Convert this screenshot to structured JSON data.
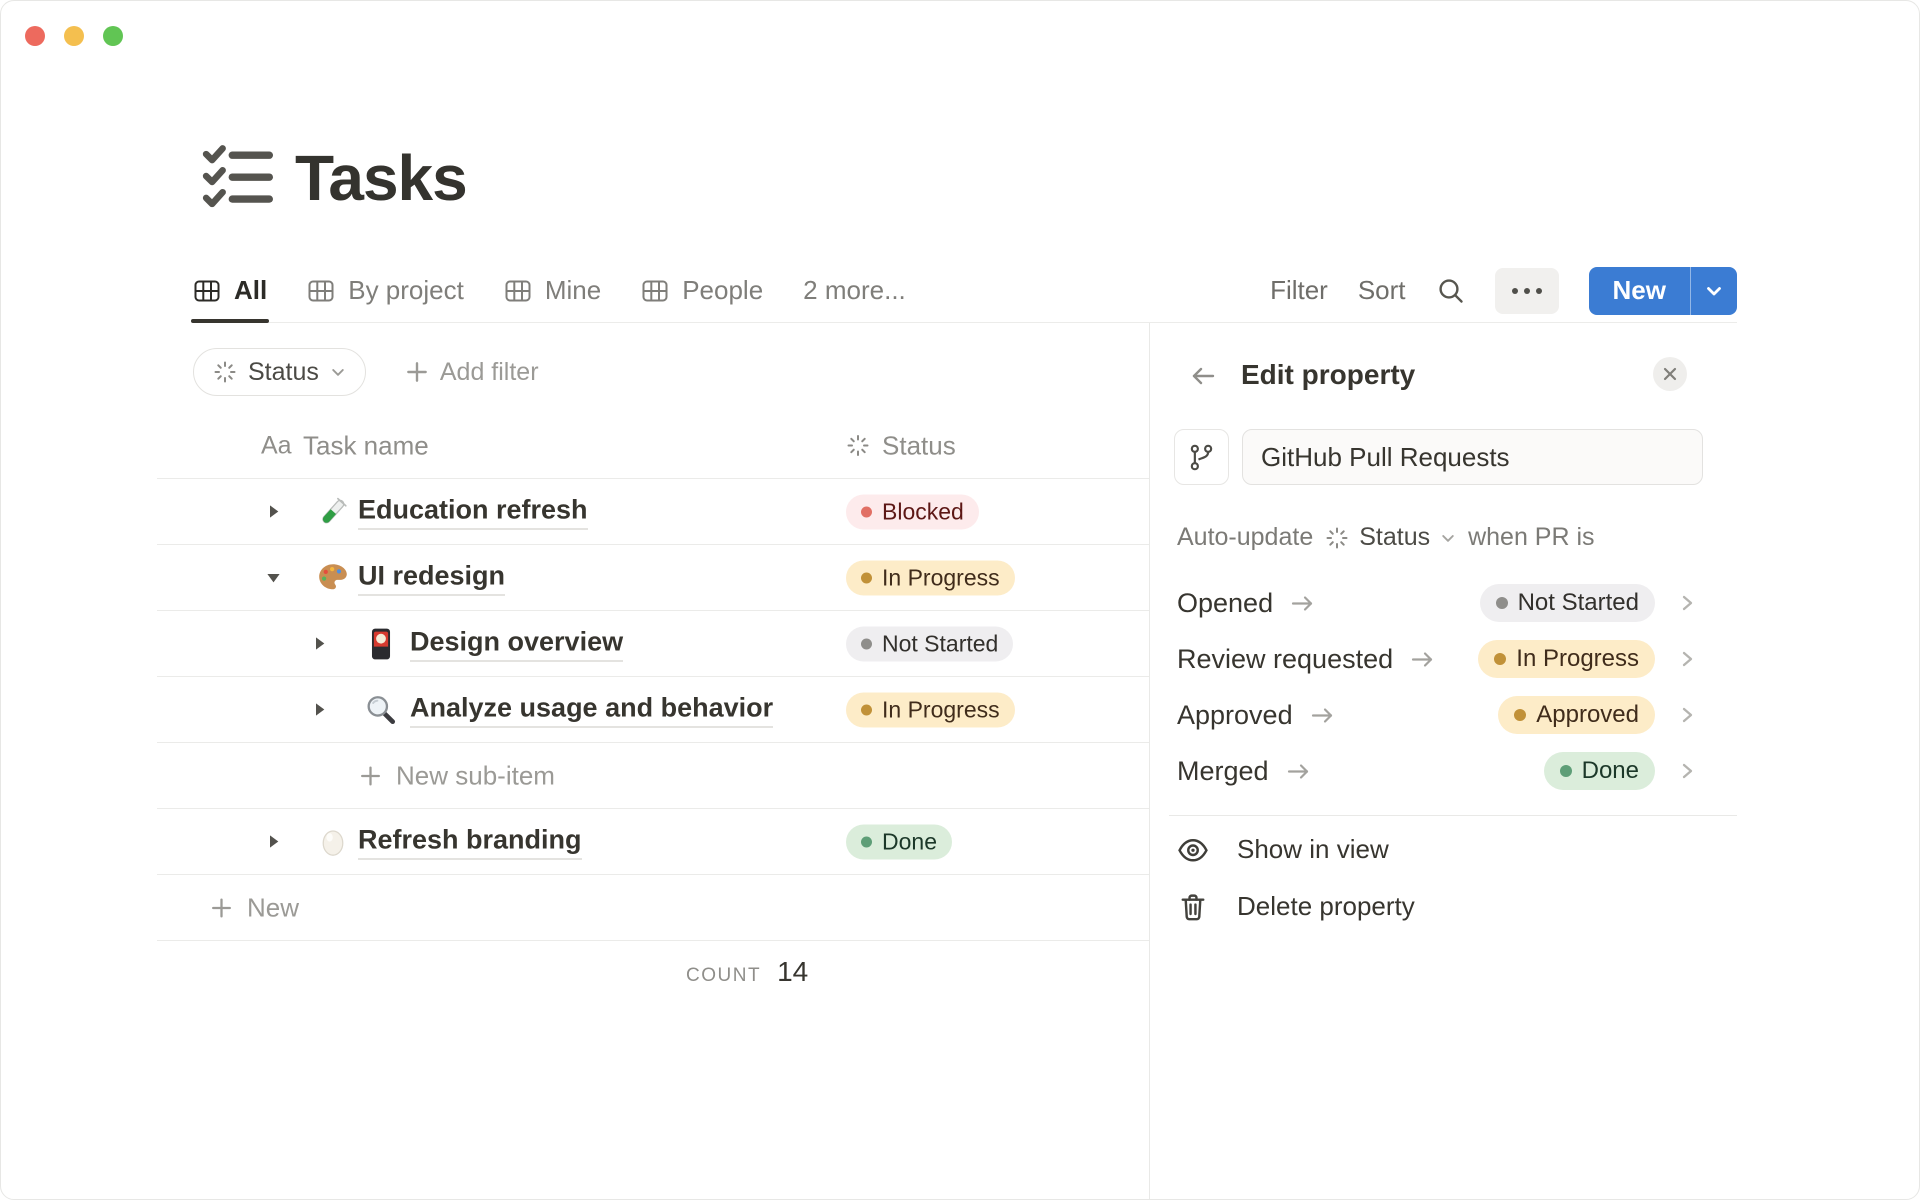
{
  "colors": {
    "accent_blue": "#3b7cd3",
    "text_primary": "#37352f",
    "text_secondary": "#787774",
    "divider": "#e9e9e7",
    "badge_red_bg": "#fdebec",
    "badge_red_dot": "#e16f64",
    "badge_red_text": "#5d1715",
    "badge_yellow_bg": "#fdecc8",
    "badge_yellow_dot": "#c19138",
    "badge_yellow_text": "#402c1b",
    "badge_gray_bg": "#efeef0",
    "badge_gray_dot": "#8f8e8b",
    "badge_gray_text": "#32302c",
    "badge_green_bg": "#dbeddb",
    "badge_green_dot": "#5e9e77",
    "badge_green_text": "#1c3829",
    "traffic_red": "#ed6a5e",
    "traffic_yellow": "#f4bf4f",
    "traffic_green": "#61c554"
  },
  "page": {
    "title": "Tasks",
    "title_icon": "checklist-icon"
  },
  "tabs": [
    {
      "label": "All",
      "icon": "table-icon",
      "active": true
    },
    {
      "label": "By project",
      "icon": "table-icon",
      "active": false
    },
    {
      "label": "Mine",
      "icon": "table-icon",
      "active": false
    },
    {
      "label": "People",
      "icon": "table-icon",
      "active": false
    },
    {
      "label": "2 more...",
      "icon": null,
      "active": false
    }
  ],
  "toolbar": {
    "filter_label": "Filter",
    "sort_label": "Sort",
    "search_icon": "search-icon",
    "more_icon": "ellipsis-icon",
    "new_button_label": "New"
  },
  "filter_bar": {
    "status_chip_label": "Status",
    "add_filter_label": "Add filter"
  },
  "table": {
    "header": {
      "name_icon": "Aa",
      "name_label": "Task name",
      "status_icon": "status-burst-icon",
      "status_label": "Status"
    },
    "rows": [
      {
        "name": "Education refresh",
        "icon": "test-tube-icon",
        "level": 0,
        "toggle": "collapsed",
        "status": "Blocked",
        "status_color": "red"
      },
      {
        "name": "UI redesign",
        "icon": "palette-icon",
        "level": 0,
        "toggle": "expanded",
        "status": "In Progress",
        "status_color": "yellow"
      },
      {
        "name": "Design overview",
        "icon": "flower-card-icon",
        "level": 1,
        "toggle": "collapsed",
        "status": "Not Started",
        "status_color": "gray"
      },
      {
        "name": "Analyze usage and behavior",
        "icon": "magnifier-icon",
        "level": 1,
        "toggle": "collapsed",
        "status": "In Progress",
        "status_color": "yellow"
      },
      {
        "name": "Refresh branding",
        "icon": "egg-icon",
        "level": 0,
        "toggle": "collapsed",
        "status": "Done",
        "status_color": "green"
      }
    ],
    "new_sub_item_label": "New sub-item",
    "new_row_label": "New",
    "footer": {
      "count_label": "COUNT",
      "count_value": "14"
    }
  },
  "panel": {
    "title": "Edit property",
    "property": {
      "icon": "git-branch-icon",
      "name_value": "GitHub Pull Requests"
    },
    "auto_update": {
      "prefix": "Auto-update",
      "status_label": "Status",
      "suffix": "when PR is"
    },
    "mappings": [
      {
        "event": "Opened",
        "status": "Not Started",
        "status_color": "gray"
      },
      {
        "event": "Review requested",
        "status": "In Progress",
        "status_color": "yellow"
      },
      {
        "event": "Approved",
        "status": "Approved",
        "status_color": "yellow"
      },
      {
        "event": "Merged",
        "status": "Done",
        "status_color": "green"
      }
    ],
    "actions": [
      {
        "label": "Show in view",
        "icon": "eye-icon"
      },
      {
        "label": "Delete property",
        "icon": "trash-icon"
      }
    ]
  }
}
